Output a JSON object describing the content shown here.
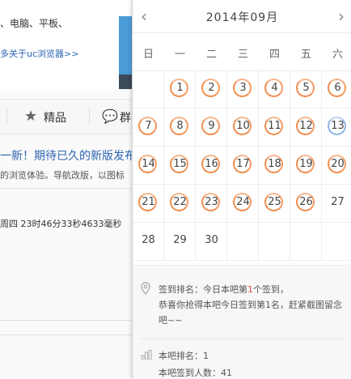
{
  "background": {
    "line1": "、电脑、平板、",
    "link": "多关于uc浏览器>>",
    "tab_good": "精品",
    "tab_group": "群",
    "post_title": "一新！期待已久的新版发布",
    "post_desc": "的浏览体验。导航改版，以图标",
    "post_time": "周四 23时46分33秒4633毫秒"
  },
  "calendar": {
    "month_title": "2014年09月",
    "weekdays": [
      "日",
      "一",
      "二",
      "三",
      "四",
      "五",
      "六"
    ],
    "days": [
      "1",
      "2",
      "3",
      "4",
      "5",
      "6",
      "7",
      "8",
      "9",
      "10",
      "11",
      "12",
      "13",
      "14",
      "15",
      "16",
      "17",
      "18",
      "19",
      "20",
      "21",
      "22",
      "23",
      "24",
      "25",
      "26",
      "27",
      "28",
      "29",
      "30"
    ],
    "first_weekday_index": 1,
    "signed_days": [
      1,
      2,
      3,
      4,
      5,
      6,
      7,
      8,
      9,
      10,
      11,
      12,
      14,
      15,
      16,
      17,
      18,
      19,
      20,
      21,
      22,
      23,
      24,
      25,
      26
    ],
    "today": 13,
    "ring_color": "#f08d4f",
    "today_ring_color": "#8fb6e6"
  },
  "info": {
    "rank_prefix": "签到排名：今日本吧第",
    "rank_number": "1",
    "rank_suffix": "个签到，",
    "rank_line2": "恭喜你抢得本吧今日签到第1名，赶紧截图留念吧~~",
    "bar_rank": "本吧排名：1",
    "bar_count": "本吧签到人数：41"
  }
}
